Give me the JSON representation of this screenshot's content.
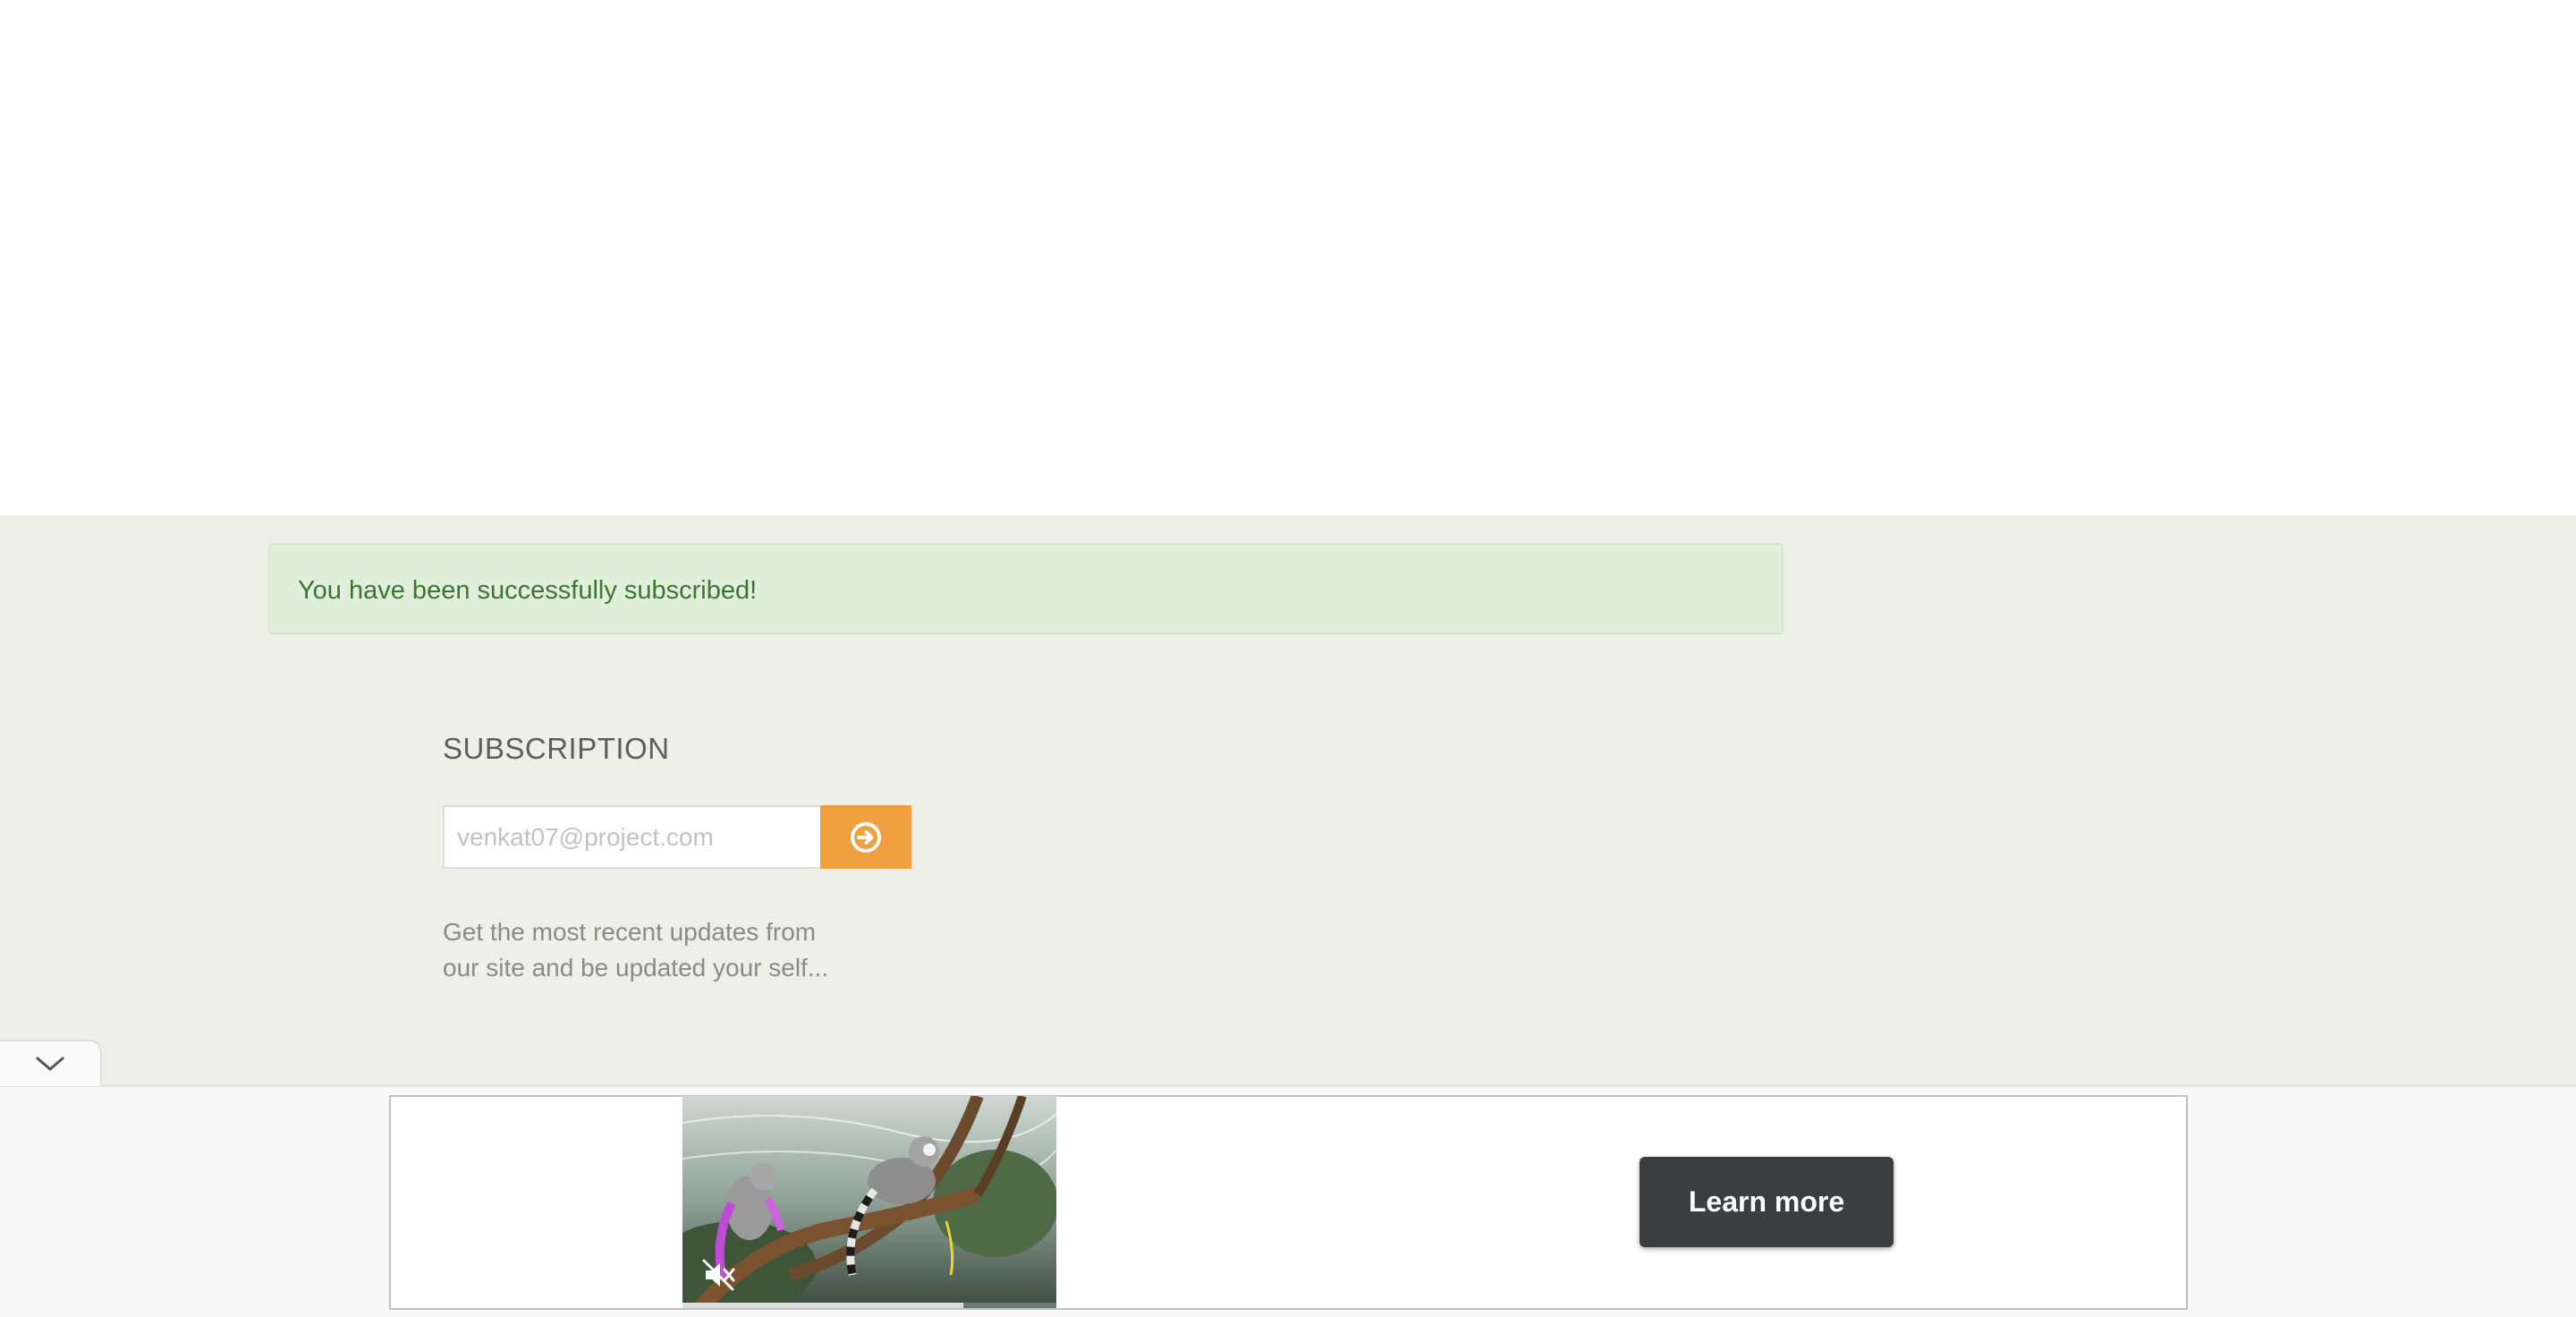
{
  "alert": {
    "message": "You have been successfully subscribed!"
  },
  "subscription": {
    "title": "SUBSCRIPTION",
    "email_placeholder": "venkat07@project.com",
    "submit_icon": "arrow-circle-right-icon",
    "description_line1": "Get the most recent updates from",
    "description_line2": "our site and be updated your self..."
  },
  "ad": {
    "collapse_icon": "chevron-down-icon",
    "media_icon": "muted-speaker-icon",
    "video_progress": 0.75,
    "cta_label": "Learn more"
  },
  "colors": {
    "footer_bg": "#efefe9",
    "alert_bg": "#e1eed9",
    "alert_text": "#3c7634",
    "accent_orange": "#f0a13f",
    "cta_bg": "#3b3d40"
  }
}
